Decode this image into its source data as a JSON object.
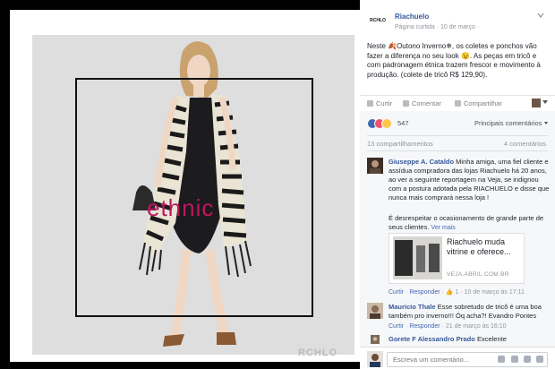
{
  "photo": {
    "overlay_text": "ethnic",
    "watermark": "RCHLO"
  },
  "post": {
    "page_logo_text": "RCHLO",
    "page_name": "Riachuelo",
    "meta": "Página curtida · 10 de março ·",
    "text": "Neste 🍂Outono Inverno❄, os coletes e ponchos vão fazer a diferença no seu look 😉. As peças em tricô e com padronagem étnica trazem frescor e movimento à produção. (colete de tricô R$ 129,90)."
  },
  "actions": {
    "like": "Curtir",
    "comment": "Comentar",
    "share": "Compartilhar"
  },
  "reactions": {
    "count": "547",
    "sort_label": "Principais comentários",
    "colors": {
      "like": "#4267b2",
      "love": "#f25268",
      "wow": "#fcc84a"
    }
  },
  "stats": {
    "shares": "13 compartilhamentos",
    "comments": "4 comentários"
  },
  "comments": [
    {
      "name": "Giuseppe A. Cataldo",
      "text": "Minha amiga, uma fiel cliente e assídua compradora das lojas Riachuelo há 20 anos, ao ver a seguinte reportagem na Veja, se indignou com a postura adotada pela RIACHUELO e disse que nunca mais comprará nessa loja !",
      "extra": "É desrespeitar o ocasionamento de grande parte de seus clientes.",
      "more": "Ver mais",
      "preview_title": "Riachuelo muda vitrine e oferece...",
      "preview_domain": "VEJA.ABRIL.COM.BR",
      "like": "Curtir",
      "reply": "Responder",
      "likes": "1",
      "date": "10 de março às 17:11"
    },
    {
      "name": "Mauricio Thale",
      "text": "Esse sobretudo de tricô é uma boa também pro inverno!!! Óq acha?! Evandro Pontes",
      "like": "Curtir",
      "reply": "Responder",
      "date": "21 de março às 16:10"
    },
    {
      "name": "Gorete F Alessandro Prado",
      "text": "Excelente"
    }
  ],
  "composer": {
    "placeholder": "Escreva um comentário..."
  }
}
